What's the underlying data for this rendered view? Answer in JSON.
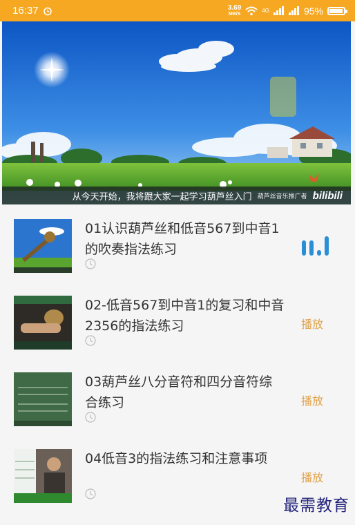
{
  "status_bar": {
    "time": "16:37",
    "net_speed_value": "3.69",
    "net_speed_unit": "MB/S",
    "network_4g": "4G",
    "battery": "95%",
    "battery_level": 0.95
  },
  "video": {
    "subtitle": "从今天开始，我将跟大家一起学习葫芦丝入门",
    "promo": "葫芦丝音乐推广者",
    "logo": "bilibili"
  },
  "lessons": [
    {
      "title": "01认识葫芦丝和低音567到中音1的吹奏指法练习",
      "state": "playing",
      "action": ""
    },
    {
      "title": "02-低音567到中音1的复习和中音2356的指法练习",
      "state": "idle",
      "action": "播放"
    },
    {
      "title": "03葫芦丝八分音符和四分音符综合练习",
      "state": "idle",
      "action": "播放"
    },
    {
      "title": "04低音3的指法练习和注意事项",
      "state": "idle",
      "action": "播放"
    }
  ],
  "watermark": "最需教育",
  "colors": {
    "status_bar": "#f7a823",
    "accent": "#e0a24b",
    "playing": "#2a8fd6",
    "sky": "#1f72d6",
    "grass": "#4ea52c"
  }
}
